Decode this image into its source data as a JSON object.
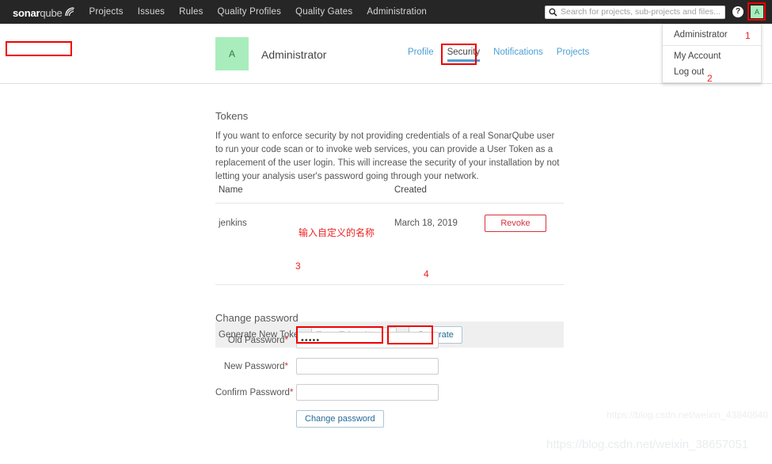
{
  "navbar": {
    "brand": {
      "bold": "sonar",
      "light": "qube",
      "mark": "wave-icon"
    },
    "links": [
      {
        "label": "Projects",
        "name": "nav-link-projects"
      },
      {
        "label": "Issues",
        "name": "nav-link-issues"
      },
      {
        "label": "Rules",
        "name": "nav-link-rules"
      },
      {
        "label": "Quality Profiles",
        "name": "nav-link-quality-profiles"
      },
      {
        "label": "Quality Gates",
        "name": "nav-link-quality-gates"
      },
      {
        "label": "Administration",
        "name": "nav-link-administration"
      }
    ],
    "search": {
      "placeholder": "Search for projects, sub-projects and files...",
      "value": ""
    },
    "help_label": "?",
    "avatar_initial": "A"
  },
  "dropdown": {
    "items": [
      {
        "label": "Administrator"
      },
      {
        "label": "My Account"
      },
      {
        "label": "Log out"
      }
    ]
  },
  "annotations": {
    "n1": "1",
    "n2": "2",
    "n3": "3",
    "n4": "4",
    "cn_token_name": "输入自定义的名称"
  },
  "account": {
    "avatar_initial": "A",
    "name": "Administrator",
    "tabs": [
      {
        "label": "Profile",
        "active": false
      },
      {
        "label": "Security",
        "active": true
      },
      {
        "label": "Notifications",
        "active": false
      },
      {
        "label": "Projects",
        "active": false
      }
    ]
  },
  "tokens": {
    "title": "Tokens",
    "description": "If you want to enforce security by not providing credentials of a real SonarQube user to run your code scan or to invoke web services, you can provide a User Token as a replacement of the user login. This will increase the security of your installation by not letting your analysis user's password going through your network.",
    "columns": {
      "name": "Name",
      "created": "Created",
      "actions": ""
    },
    "rows": [
      {
        "name": "jenkins",
        "created": "March 18, 2019",
        "action_label": "Revoke"
      }
    ],
    "generate_label": "Generate New Token:",
    "token_placeholder": "Enter Token Name",
    "token_value": "",
    "generate_button": "Generate"
  },
  "change_password": {
    "title": "Change password",
    "fields": [
      {
        "label": "Old Password",
        "required": "*",
        "value": "•••••",
        "type": "password"
      },
      {
        "label": "New Password",
        "required": "*",
        "value": "",
        "type": "password"
      },
      {
        "label": "Confirm Password",
        "required": "*",
        "value": "",
        "type": "password"
      }
    ],
    "submit_label": "Change password"
  },
  "watermarks": {
    "top": "https://blog.csdn.net/weixin_43840640",
    "bottom": "https://blog.csdn.net/weixin_38657051"
  },
  "colors": {
    "navbar_bg": "#262626",
    "accent_blue": "#4b9fd5",
    "avatar_green": "#a9edbd",
    "danger_red": "#d4333f",
    "annotation_red": "#ee0000"
  }
}
